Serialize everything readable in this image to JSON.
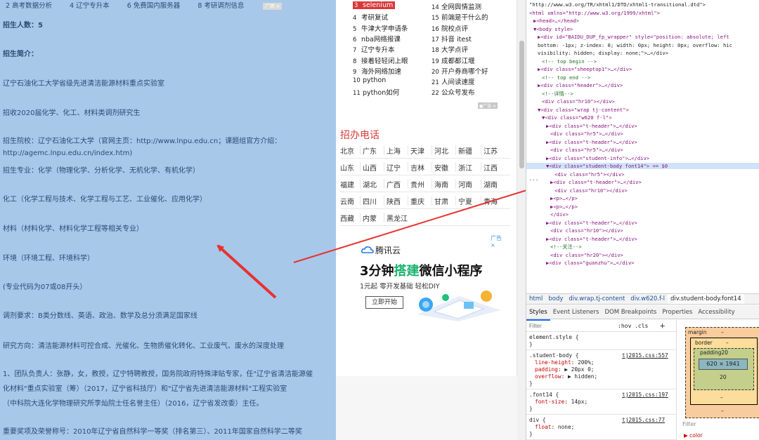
{
  "left": {
    "topbar": [
      "2 高考数据分析",
      "4 辽宁专升本",
      "6 免费国内服务器",
      "8 考研调剂信息"
    ],
    "topbar_ad": "广告 ×",
    "lines": [
      "招生人数：5",
      "招生简介：",
      "辽宁石油化工大学省级先进清洁能源材料重点实验室",
      "招收2020届化学、化工、材料类调剂研究生",
      "招生院校：辽宁石油化工大学（官网主页：http://www.lnpu.edu.cn；课题组官方介绍：",
      "http://agemc.lnpu.edu.cn/index.htm)",
      "招生专业：化学（物理化学、分析化学、无机化学、有机化学）",
      "化工（化学工程与技术、化学工程与工艺、工业催化、应用化学）",
      "材料（材料化学、材料化学工程等相关专业）",
      "环境（环境工程、环境科学）",
      "(专业代码为07或08开头）",
      "调剂要求：B类分数线、英语、政治、数学及总分须满足国家线",
      "研究方向：清洁能源材料可控合成、光催化、生物质催化转化、工业废气、废水的深度处理",
      "1、团队负责人：张静，女，教授，辽宁特聘教授，国务院政府特殊津贴专家，任\"辽宁省清洁能源催",
      "化材料\"重点实验室（筹）（2017，辽宁省科技厅）和\"辽宁省先进清洁能源材料\"工程实验室",
      "（中科院大连化学物理研究所李灿院士任名誉主任）（2016，辽宁省发改委）主任。",
      "重要奖项及荣誉称号：2010年辽宁省自然科学一等奖（排名第三）、2011年国家自然科学二等奖"
    ]
  },
  "hot_left": [
    {
      "num": "3",
      "label": "selenium"
    },
    {
      "num": "4",
      "label": "考研复试"
    },
    {
      "num": "5",
      "label": "牛津大学申请条"
    },
    {
      "num": "6",
      "label": "nba网络报课"
    },
    {
      "num": "7",
      "label": "辽宁专升本"
    },
    {
      "num": "8",
      "label": "接着轻轻闭上眼"
    },
    {
      "num": "9",
      "label": "海外网络加速"
    },
    {
      "num": "10",
      "label": "python"
    },
    {
      "num": "11",
      "label": "python如何"
    }
  ],
  "hot_right": [
    {
      "num": "14",
      "label": "全网舆情监测"
    },
    {
      "num": "15",
      "label": "前端是干什么的"
    },
    {
      "num": "16",
      "label": "院校点评"
    },
    {
      "num": "17",
      "label": "抖音 itest"
    },
    {
      "num": "18",
      "label": "大学点评"
    },
    {
      "num": "19",
      "label": "成都都江堰"
    },
    {
      "num": "20",
      "label": "开户券商哪个好"
    },
    {
      "num": "21",
      "label": "人间读速度"
    },
    {
      "num": "22",
      "label": "公众号发布"
    }
  ],
  "hot_ad": "●广告 ×",
  "phone_title": "招办电话",
  "provinces": [
    [
      "北京",
      "广东",
      "上海",
      "天津",
      "河北",
      "新疆",
      "江苏"
    ],
    [
      "山东",
      "山西",
      "辽宁",
      "吉林",
      "安徽",
      "浙江",
      "江西"
    ],
    [
      "福建",
      "湖北",
      "广西",
      "贵州",
      "海南",
      "河南",
      "湖南"
    ],
    [
      "云南",
      "四川",
      "陕西",
      "重庆",
      "甘肃",
      "宁夏",
      "青海"
    ],
    [
      "西藏",
      "内蒙",
      "黑龙江"
    ]
  ],
  "ad": {
    "tag": "广告 ×",
    "brand": "腾讯云",
    "headline_pre": "3分钟",
    "headline_hl": "搭建",
    "headline_post": "微信小程序",
    "sub": "1元起 零开发基础 轻松DIY",
    "button": "立即开始"
  },
  "dom_lines": [
    {
      "html": "\"http://www.w3.org/TR/xhtml1/DTD/xhtml1-transitional.dtd\">",
      "indent": 0,
      "cls": "tx"
    },
    {
      "html": "<html xmlns=\"http://www.w3.org/1999/xhtml\">",
      "indent": 0,
      "cls": ""
    },
    {
      "html": "▶<head>…</head>",
      "indent": 1,
      "cls": ""
    },
    {
      "html": "▼<body style>",
      "indent": 1,
      "cls": ""
    },
    {
      "html": "▶<div id=\"BAIDU_DUP_fp_wrapper\" style=\"position: absolute; left",
      "indent": 2,
      "cls": ""
    },
    {
      "html": "bottom: -1px; z-index: 0; width: 0px; height: 0px; overflow: hic",
      "indent": 2,
      "cls": "tx"
    },
    {
      "html": "visibility: hidden; display: none;\">…</div>",
      "indent": 2,
      "cls": "tx"
    },
    {
      "html": "<!-- top begin -->",
      "indent": 3,
      "cls": "cm"
    },
    {
      "html": "▶<div class=\"sheeptop1\">…</div>",
      "indent": 2,
      "cls": ""
    },
    {
      "html": "<!-- top end -->",
      "indent": 3,
      "cls": "cm"
    },
    {
      "html": "▶<div class=\"header\">…</div>",
      "indent": 2,
      "cls": ""
    },
    {
      "html": "<!--详情-->",
      "indent": 3,
      "cls": "cm"
    },
    {
      "html": "<div class=\"hr10\"></div>",
      "indent": 3,
      "cls": ""
    },
    {
      "html": "▼<div class=\"wrap tj-content\">",
      "indent": 2,
      "cls": ""
    },
    {
      "html": "▼<div class=\"w620 f-l\">",
      "indent": 3,
      "cls": ""
    },
    {
      "html": "▶<div class=\"t-header\">…</div>",
      "indent": 4,
      "cls": ""
    },
    {
      "html": "<div class=\"hr5\">…</div>",
      "indent": 5,
      "cls": ""
    },
    {
      "html": "▶<div class=\"t-header\">…</div>",
      "indent": 4,
      "cls": ""
    },
    {
      "html": "<div class=\"hr5\">…</div>",
      "indent": 5,
      "cls": ""
    },
    {
      "html": "▶<div class=\"student-info\">…</div>",
      "indent": 4,
      "cls": ""
    },
    {
      "html": "▼<div class=\"student-body font14\"> == $0",
      "indent": 4,
      "cls": "selrow"
    },
    {
      "html": "<div class=\"hr5\"></div>",
      "indent": 6,
      "cls": ""
    },
    {
      "html": "▶<div class=\"t-header\">…</div>",
      "indent": 5,
      "cls": ""
    },
    {
      "html": "<div class=\"hr10\"></div>",
      "indent": 6,
      "cls": ""
    },
    {
      "html": "▶<p>…</p>",
      "indent": 5,
      "cls": ""
    },
    {
      "html": "▶<p>…</p>",
      "indent": 5,
      "cls": ""
    },
    {
      "html": "</div>",
      "indent": 5,
      "cls": ""
    },
    {
      "html": "▶<div class=\"t-header\">…</div>",
      "indent": 4,
      "cls": ""
    },
    {
      "html": "<div class=\"hr10\"></div>",
      "indent": 5,
      "cls": ""
    },
    {
      "html": "▶<div class=\"t-header\">…</div>",
      "indent": 4,
      "cls": ""
    },
    {
      "html": "<!--关注-->",
      "indent": 5,
      "cls": "cm"
    },
    {
      "html": "<div class=\"hr20\"></div>",
      "indent": 5,
      "cls": ""
    },
    {
      "html": "▶<div class=\"guanzhu\">…</div>",
      "indent": 4,
      "cls": ""
    }
  ],
  "dom_dots": "···",
  "breadcrumbs": [
    "html",
    "body",
    "div.wrap.tj-content",
    "div.w620.f-l",
    "div.student-body.font14"
  ],
  "devtools_tabs": [
    "Styles",
    "Event Listeners",
    "DOM Breakpoints",
    "Properties",
    "Accessibility"
  ],
  "styles": {
    "filter_placeholder": "Filter",
    "hov": ":hov .cls",
    "plus": "+",
    "rules": [
      {
        "selector": "element.style {",
        "props": [],
        "src": ""
      },
      {
        "selector": ".student-body {",
        "props": [
          [
            "line-height",
            "200%;"
          ],
          [
            "padding",
            "▶ 20px 0;"
          ],
          [
            "overflow",
            "▶ hidden;"
          ]
        ],
        "src": "tj2015.css:557"
      },
      {
        "selector": ".font14 {",
        "props": [
          [
            "font-size",
            "14px;"
          ]
        ],
        "src": "tj2015.css:197"
      },
      {
        "selector": "div {",
        "props": [
          [
            "float",
            "none;"
          ]
        ],
        "src": "tj2015.css:77"
      }
    ]
  },
  "boxmodel": {
    "margin": "margin",
    "border": "border",
    "padding": "padding20",
    "content": "620 × 1941",
    "bottom_padding": "20",
    "dash": "–"
  },
  "lower_filter": "Filter",
  "color_prop": "▶ color"
}
